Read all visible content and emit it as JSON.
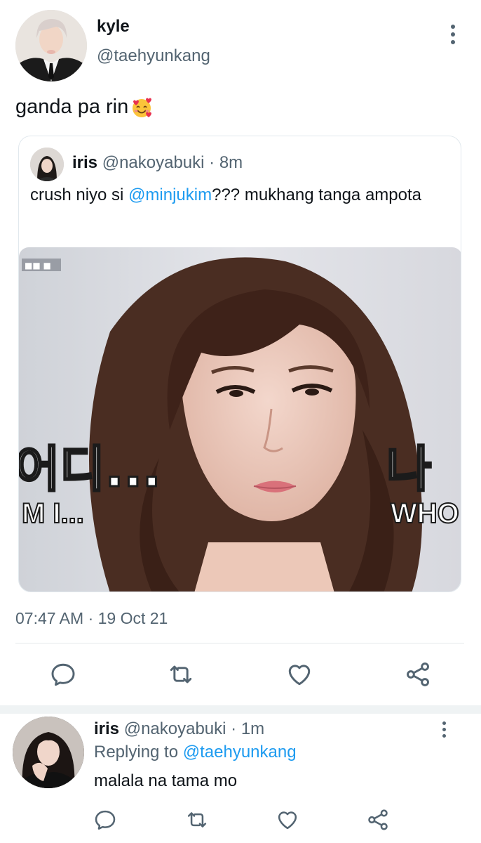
{
  "tweet": {
    "display_name": "kyle",
    "handle": "@taehyunkang",
    "text": "ganda pa rin",
    "emoji": "smiling-face-with-hearts",
    "timestamp": "07:47 AM · 19 Oct 21"
  },
  "quote": {
    "name": "iris",
    "handle": "@nakoyabuki",
    "time": "8m",
    "meta": "@nakoyabuki · 8m",
    "text_before": "crush niyo si ",
    "mention": "@minjukim",
    "text_after": "??? mukhang tanga ampota",
    "image": {
      "caption_left_korean": "어디...",
      "caption_left_english": "M I...",
      "caption_right_korean": "나",
      "caption_right_english": "WHO",
      "corner_badge": "■■ ■"
    }
  },
  "actions": {
    "icons": [
      "reply-icon",
      "retweet-icon",
      "like-icon",
      "share-icon"
    ]
  },
  "reply": {
    "name": "iris",
    "handle": "@nakoyabuki",
    "time": "1m",
    "meta": "@nakoyabuki · 1m",
    "replying_prefix": "Replying to",
    "replying_to": "@taehyunkang",
    "text": "malala na tama mo"
  },
  "colors": {
    "link": "#1d9bf0",
    "secondary_text": "#536471",
    "primary_text": "#0f1419",
    "border": "#e1e8ed"
  }
}
